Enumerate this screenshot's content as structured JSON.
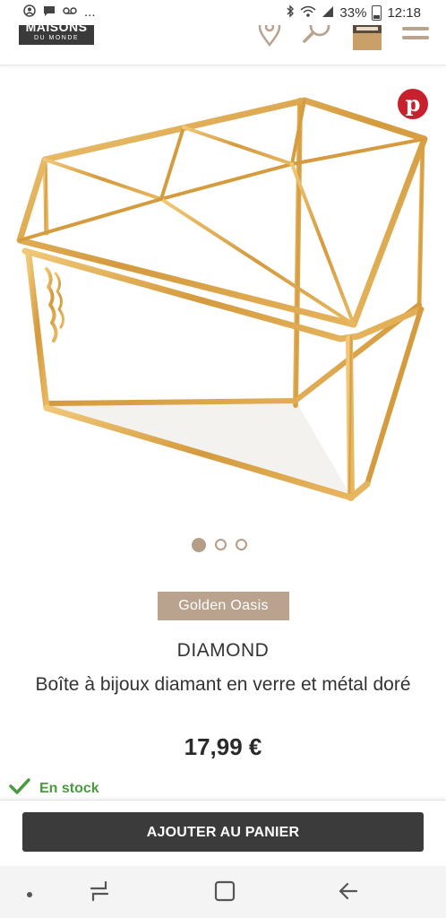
{
  "status_bar": {
    "ellipsis": "...",
    "battery_percent": "33%",
    "time": "12:18"
  },
  "header": {
    "logo_line1": "MAISONS",
    "logo_line2": "DU MONDE",
    "icons": [
      "location-pin-icon",
      "search-icon",
      "shopping-bag-icon",
      "menu-icon"
    ]
  },
  "product": {
    "image_label": "jewelry-box-photo",
    "carousel": {
      "count": 3,
      "active": 1
    },
    "collection": "Golden Oasis",
    "name": "DIAMOND",
    "description": "Boîte à bijoux diamant en verre et métal doré",
    "price": "17,99 €",
    "stock": "En stock"
  },
  "actions": {
    "add_to_cart": "AJOUTER AU PANIER"
  },
  "colors": {
    "accent": "#b9a38e",
    "stock_green": "#4a9a3f",
    "button_dark": "#3b3b3b",
    "pinterest_red": "#c8202d",
    "gold_frame": "#d4a24a"
  }
}
